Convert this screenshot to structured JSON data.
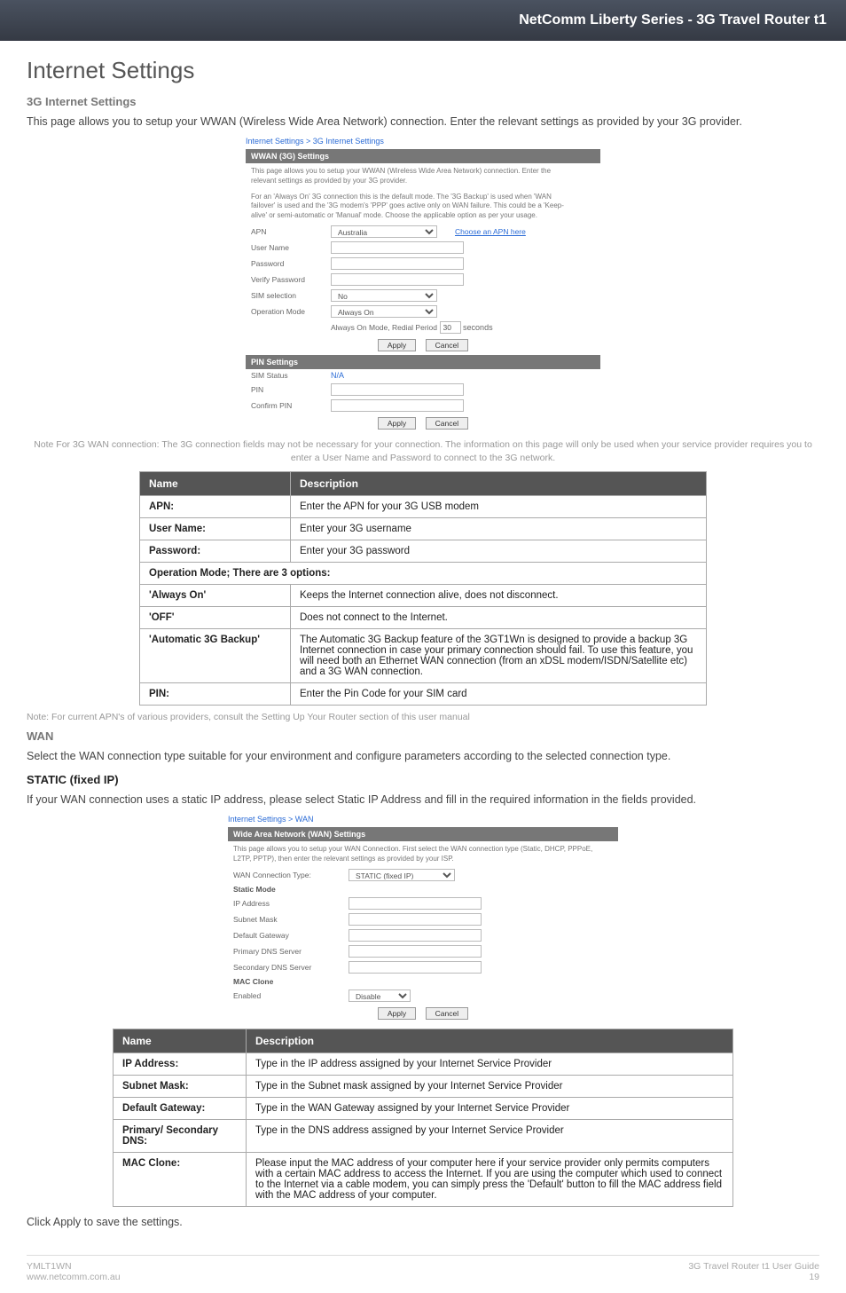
{
  "banner": "NetComm Liberty Series - 3G Travel Router t1",
  "h1": "Internet Settings",
  "sub1": "3G Internet Settings",
  "p1": "This page allows you to setup your WWAN (Wireless Wide Area Network) connection. Enter the relevant settings as provided by your 3G provider.",
  "ss1": {
    "crumb": "Internet Settings > 3G Internet Settings",
    "bar1": "WWAN (3G) Settings",
    "note1": "This page allows you to setup your WWAN (Wireless Wide Area Network) connection. Enter the relevant settings as provided by your 3G provider.",
    "note2": "For an 'Always On' 3G connection this is the default mode. The '3G Backup' is used when 'WAN failover' is used and the '3G modem's 'PPP' goes active only on WAN failure. This could be a 'Keep-alive' or semi-automatic or 'Manual' mode. Choose the applicable option as per your usage.",
    "apn_label": "APN",
    "apn_value": "Australia",
    "choose_link": "Choose an APN here",
    "user_label": "User Name",
    "pass_label": "Password",
    "verify_label": "Verify Password",
    "sim_label": "SIM selection",
    "sim_value": "No",
    "op_label": "Operation Mode",
    "op_value": "Always On",
    "redial_label": "Always On Mode, Redial Period",
    "redial_val": "30",
    "redial_unit": "seconds",
    "apply": "Apply",
    "cancel": "Cancel",
    "bar2": "PIN Settings",
    "sim_status_label": "SIM Status",
    "sim_status_value": "N/A",
    "pin_label": "PIN",
    "confirm_label": "Confirm PIN"
  },
  "note_3g": "Note For 3G WAN connection: The 3G connection fields may not be necessary for your connection. The information on this page will only be used when your service provider requires you to enter a User Name and Password to connect to the 3G network.",
  "table1": {
    "h1": "Name",
    "h2": "Description",
    "rows": [
      {
        "n": "APN:",
        "d": "Enter the APN for your 3G USB modem"
      },
      {
        "n": "User Name:",
        "d": "Enter your 3G username"
      },
      {
        "n": "Password:",
        "d": "Enter your 3G password"
      }
    ],
    "span": "Operation Mode; There are 3 options:",
    "rows2": [
      {
        "n": "'Always On'",
        "d": "Keeps the Internet connection alive, does not disconnect."
      },
      {
        "n": "'OFF'",
        "d": "Does not connect to the Internet."
      },
      {
        "n": "'Automatic 3G Backup'",
        "d": "The Automatic 3G Backup feature of the 3GT1Wn is designed to provide a backup 3G Internet connection in case your primary connection should fail. To use this feature, you will need both an Ethernet WAN connection (from an xDSL modem/ISDN/Satellite etc) and a 3G WAN connection."
      },
      {
        "n": "PIN:",
        "d": "Enter the Pin Code for your SIM card"
      }
    ]
  },
  "note_apn": "Note: For current APN's of various providers, consult the Setting Up Your Router section of this user manual",
  "wan_head": "WAN",
  "wan_p": "Select the WAN connection type suitable for your environment and configure parameters according to the selected connection type.",
  "static_head": "STATIC (fixed IP)",
  "static_p": "If your WAN connection uses a static IP address, please select Static IP Address and fill in the required information in the fields provided.",
  "ss2": {
    "crumb": "Internet Settings > WAN",
    "bar": "Wide Area Network (WAN) Settings",
    "note": "This page allows you to setup your WAN Connection. First select the WAN connection type (Static, DHCP, PPPoE, L2TP, PPTP), then enter the relevant settings as provided by your ISP.",
    "wan_type_label": "WAN Connection Type:",
    "wan_type_value": "STATIC (fixed IP)",
    "static_mode": "Static Mode",
    "ip_label": "IP Address",
    "subnet_label": "Subnet Mask",
    "gw_label": "Default Gateway",
    "pdns_label": "Primary DNS Server",
    "sdns_label": "Secondary DNS Server",
    "mac_head": "MAC Clone",
    "enabled_label": "Enabled",
    "enabled_value": "Disable",
    "apply": "Apply",
    "cancel": "Cancel"
  },
  "table2": {
    "h1": "Name",
    "h2": "Description",
    "rows": [
      {
        "n": "IP Address:",
        "d": "Type in the IP address assigned by your Internet Service Provider"
      },
      {
        "n": "Subnet Mask:",
        "d": "Type in the Subnet mask assigned by your Internet Service Provider"
      },
      {
        "n": "Default Gateway:",
        "d": "Type in the WAN Gateway assigned by your Internet Service Provider"
      },
      {
        "n": "Primary/ Secondary DNS:",
        "d": "Type in the DNS address assigned by your Internet Service Provider"
      },
      {
        "n": "MAC Clone:",
        "d": "Please input the MAC address of your computer here if your service provider only permits computers with a certain MAC address to access the Internet. If you are using the computer which used to connect to the Internet via a cable modem, you can simply press the 'Default' button to fill the MAC address field with the MAC address of your computer."
      }
    ]
  },
  "apply_note": "Click Apply to save the settings.",
  "footer": {
    "left1": "YMLT1WN",
    "left2": "www.netcomm.com.au",
    "right1": "3G Travel Router t1 User Guide",
    "right2": "19"
  }
}
